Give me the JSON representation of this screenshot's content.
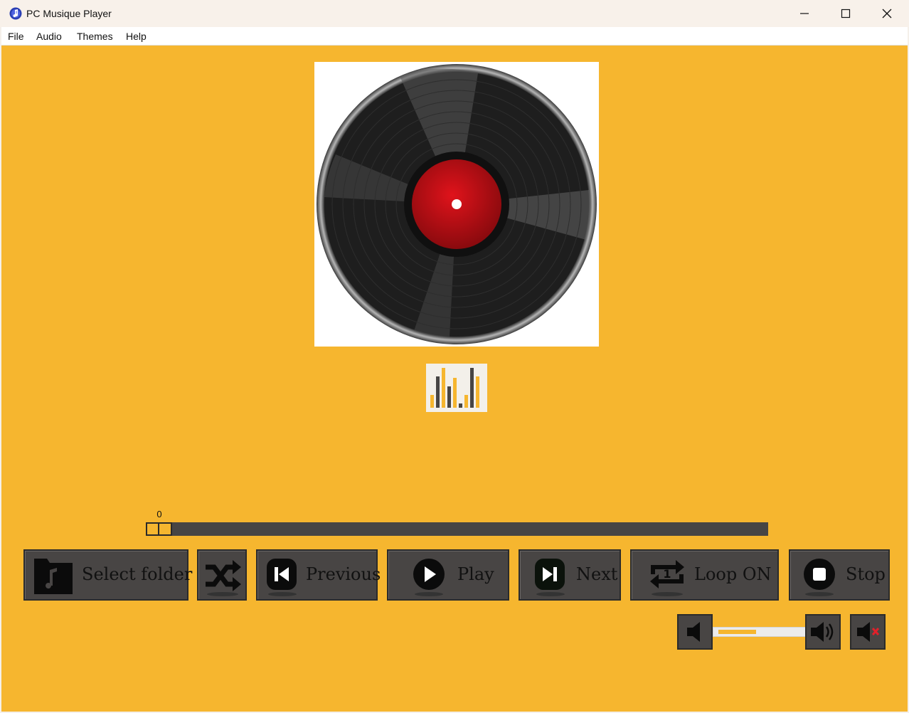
{
  "window": {
    "title": "PC Musique Player",
    "controls": [
      "minimize",
      "maximize",
      "close"
    ]
  },
  "menu": [
    "File",
    "Audio",
    "Themes",
    "Help"
  ],
  "artwork": {
    "icon": "vinyl-record-icon"
  },
  "visualizer": {
    "icon": "equalizer-bars-icon"
  },
  "playback": {
    "position_label": "0",
    "progress_percent": 0
  },
  "controls": {
    "select_folder": "Select folder",
    "shuffle_icon": "shuffle-icon",
    "previous": "Previous",
    "play": "Play",
    "next": "Next",
    "loop": "Loop ON",
    "stop": "Stop"
  },
  "volume": {
    "level_percent": 45,
    "down_icon": "volume-down-icon",
    "up_icon": "volume-up-icon",
    "mute_icon": "mute-icon"
  },
  "colors": {
    "background": "#f6b62f",
    "button": "#484544",
    "label_center": "#c8121a"
  }
}
